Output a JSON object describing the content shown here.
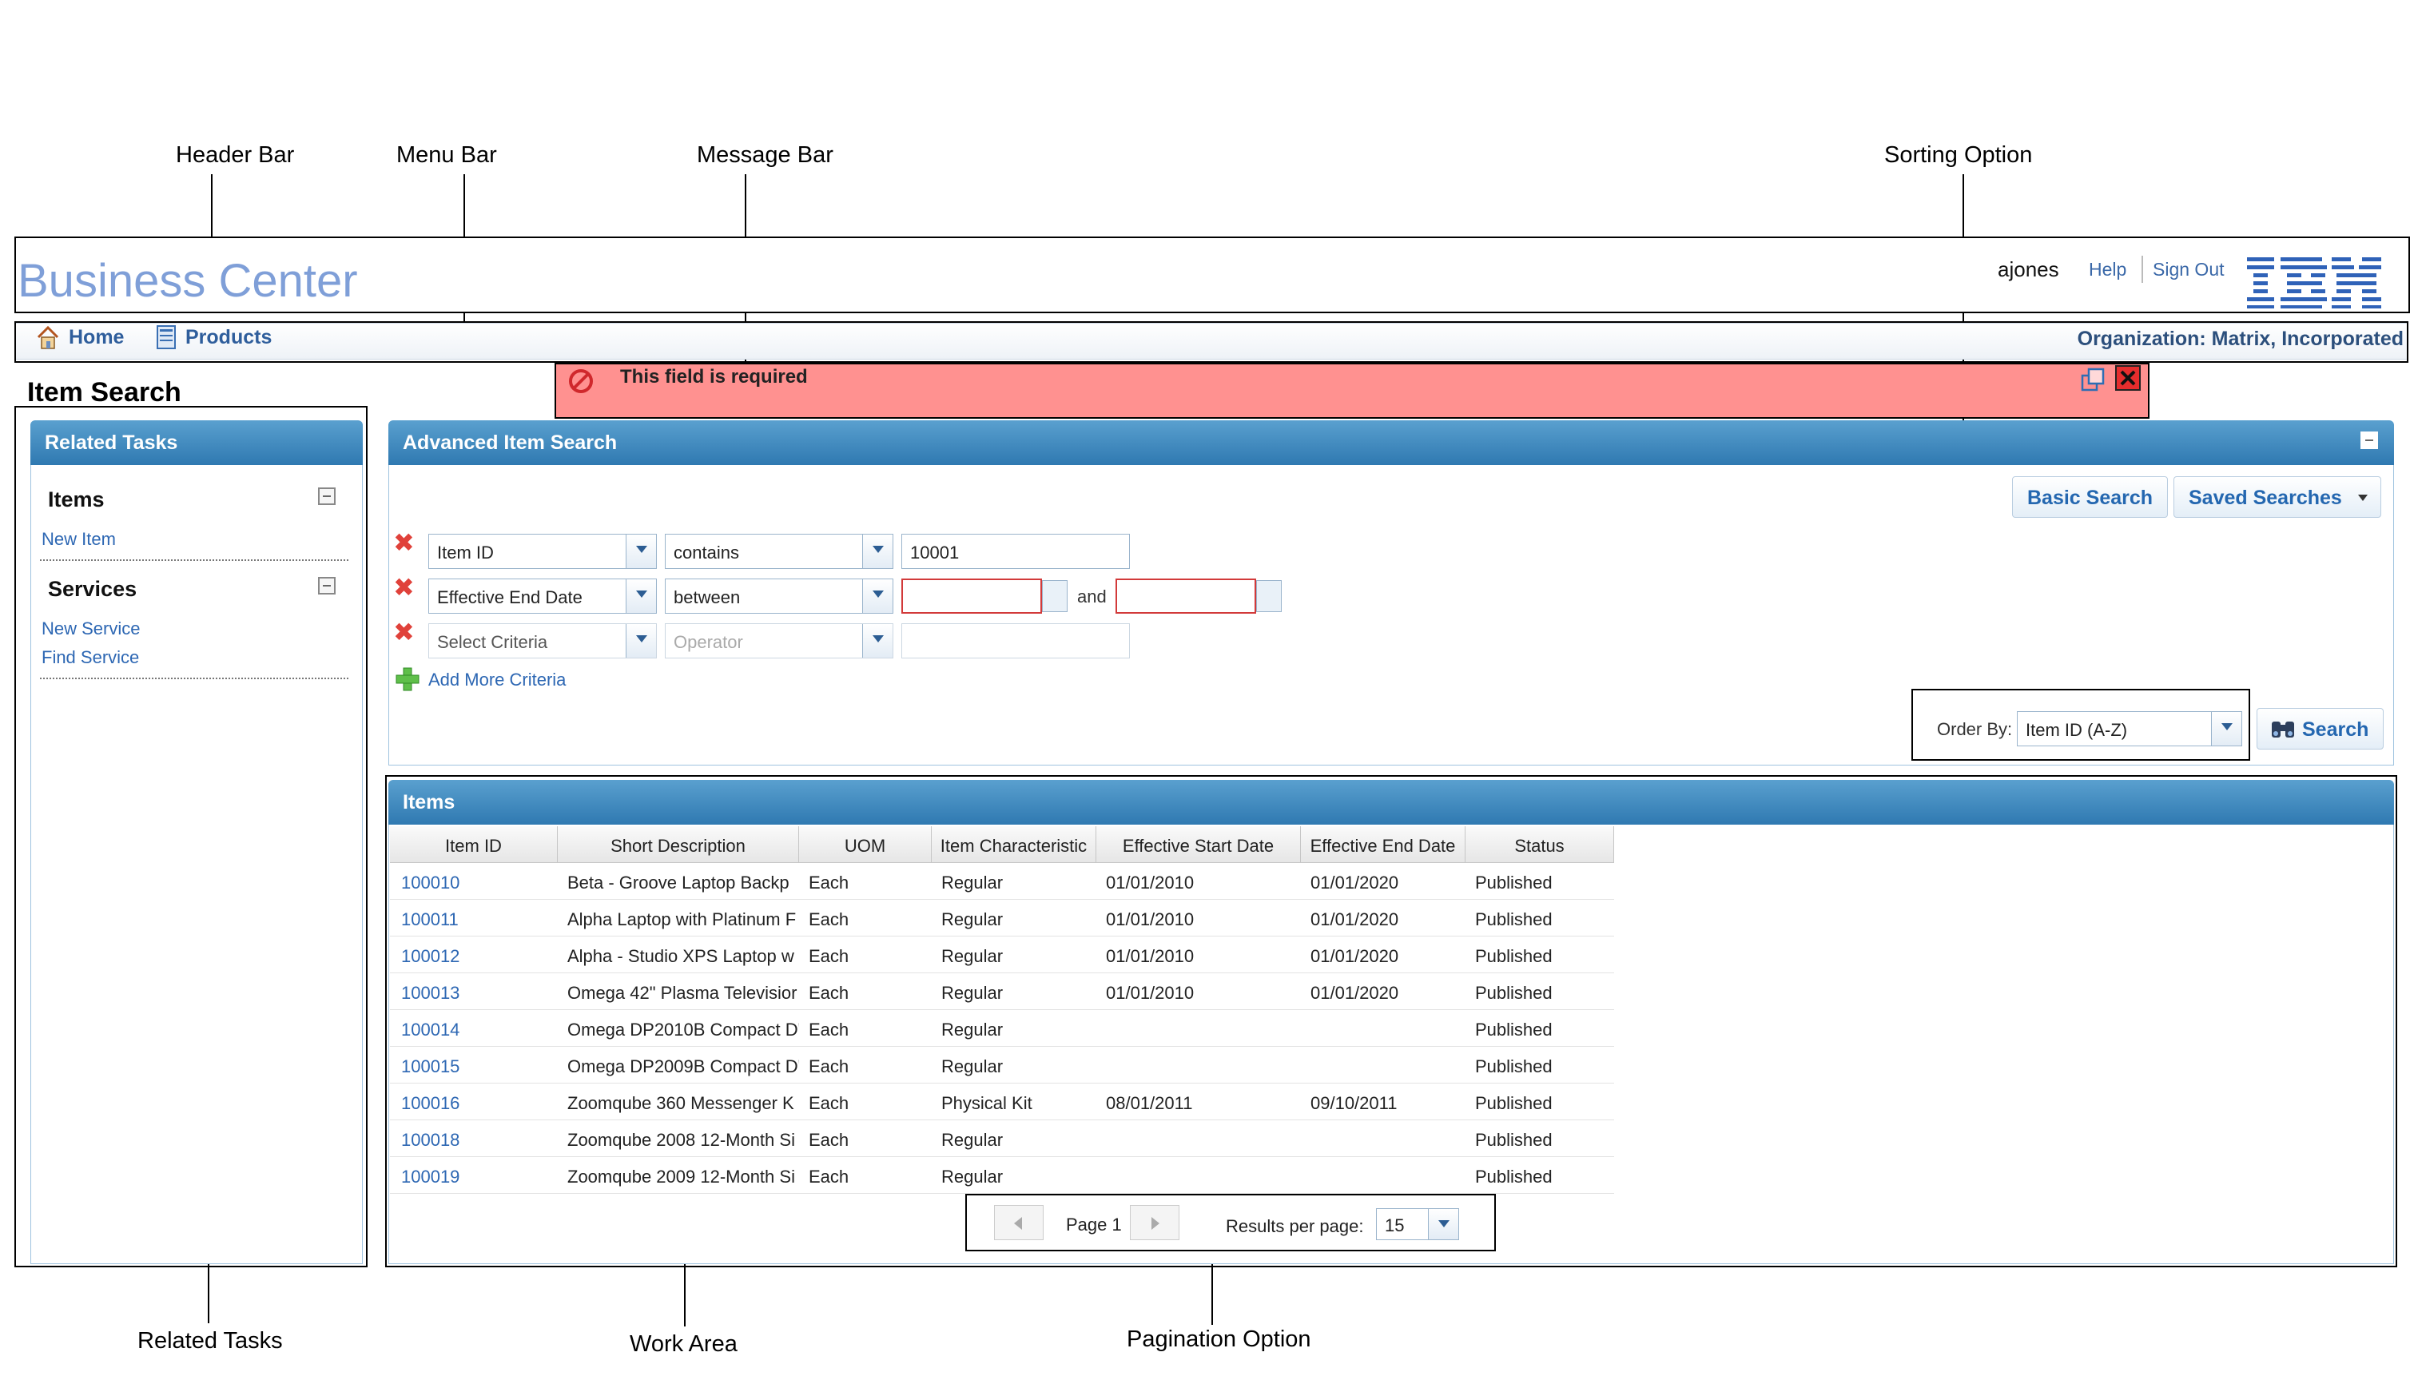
{
  "callouts": {
    "header_bar": "Header Bar",
    "menu_bar": "Menu Bar",
    "message_bar": "Message Bar",
    "sorting_option": "Sorting Option",
    "related_tasks": "Related Tasks",
    "work_area": "Work Area",
    "pagination_option": "Pagination Option"
  },
  "header": {
    "title": "Business Center",
    "user": "ajones",
    "help": "Help",
    "sign_out": "Sign Out",
    "logo": "IBM"
  },
  "menu": {
    "home": "Home",
    "products": "Products",
    "organization": "Organization: Matrix, Incorporated"
  },
  "page_title": "Item Search",
  "message": {
    "text": "This field is required"
  },
  "related_tasks": {
    "title": "Related Tasks",
    "items_heading": "Items",
    "new_item": "New Item",
    "services_heading": "Services",
    "new_service": "New Service",
    "find_service": "Find Service"
  },
  "advanced_search": {
    "title": "Advanced Item Search",
    "basic_search": "Basic Search",
    "saved_searches": "Saved Searches",
    "criteria": [
      {
        "field": "Item ID",
        "operator": "contains",
        "value": "10001"
      },
      {
        "field": "Effective End Date",
        "operator": "between",
        "and_label": "and"
      },
      {
        "field_placeholder": "Select Criteria",
        "operator_placeholder": "Operator"
      }
    ],
    "add_more": "Add More Criteria",
    "order_by_label": "Order By:",
    "order_by_value": "Item ID (A-Z)",
    "search": "Search"
  },
  "items": {
    "title": "Items",
    "columns": [
      "Item ID",
      "Short Description",
      "UOM",
      "Item Characteristic",
      "Effective Start Date",
      "Effective End Date",
      "Status"
    ],
    "rows": [
      [
        "100010",
        "Beta - Groove Laptop Backp",
        "Each",
        "Regular",
        "01/01/2010",
        "01/01/2020",
        "Published"
      ],
      [
        "100011",
        "Alpha Laptop with Platinum F",
        "Each",
        "Regular",
        "01/01/2010",
        "01/01/2020",
        "Published"
      ],
      [
        "100012",
        "Alpha - Studio XPS Laptop w",
        "Each",
        "Regular",
        "01/01/2010",
        "01/01/2020",
        "Published"
      ],
      [
        "100013",
        "Omega 42\" Plasma Televisior",
        "Each",
        "Regular",
        "01/01/2010",
        "01/01/2020",
        "Published"
      ],
      [
        "100014",
        "Omega DP2010B Compact D'",
        "Each",
        "Regular",
        "",
        "",
        "Published"
      ],
      [
        "100015",
        "Omega DP2009B Compact D'",
        "Each",
        "Regular",
        "",
        "",
        "Published"
      ],
      [
        "100016",
        "Zoomqube 360 Messenger K",
        "Each",
        "Physical Kit",
        "08/01/2011",
        "09/10/2011",
        "Published"
      ],
      [
        "100018",
        "Zoomqube 2008 12-Month Si",
        "Each",
        "Regular",
        "",
        "",
        "Published"
      ],
      [
        "100019",
        "Zoomqube 2009 12-Month Si",
        "Each",
        "Regular",
        "",
        "",
        "Published"
      ]
    ]
  },
  "pagination": {
    "page_label": "Page",
    "page_number": "1",
    "results_label": "Results per page:",
    "results_value": "15"
  },
  "icons": {
    "home": "home-icon",
    "products": "products-icon",
    "error": "error-icon",
    "remove": "remove-criteria-icon",
    "add": "add-icon",
    "search": "binoculars-icon",
    "calendar": "calendar-icon"
  },
  "colors": {
    "panel_header": "#2f79b1",
    "message_bg": "#ff9190",
    "link": "#2d67b3",
    "title": "#7f9fd8"
  }
}
